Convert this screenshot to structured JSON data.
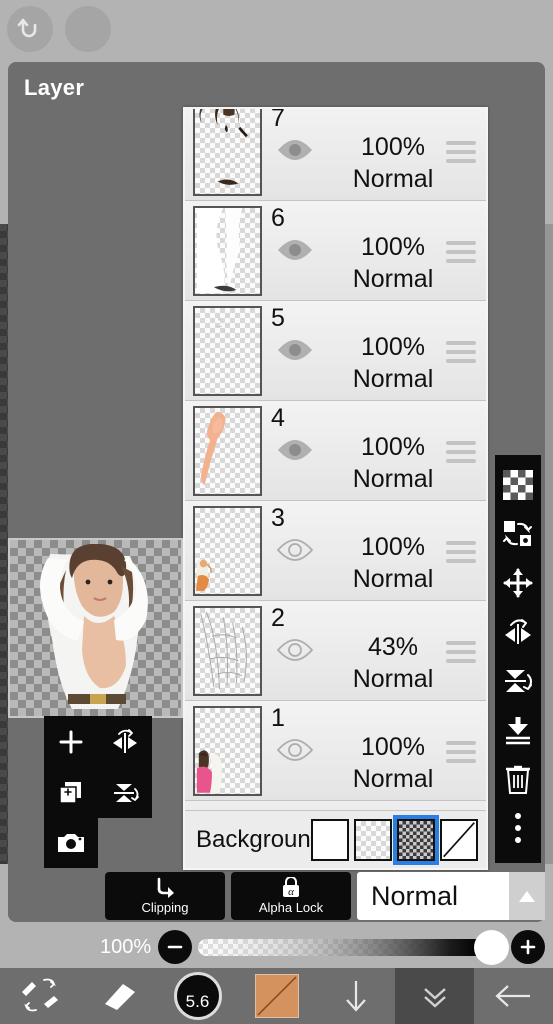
{
  "app": {
    "title": "Layer",
    "accent_blue": "#2a7fe0",
    "panel_gray": "#6e6e6e",
    "list_bg": "#ededed"
  },
  "topbar": {
    "undo_icon": "undo-icon",
    "redo_icon": "redo-icon"
  },
  "layers": [
    {
      "num": "7",
      "opacity": "100%",
      "blend": "Normal",
      "visible": true
    },
    {
      "num": "6",
      "opacity": "100%",
      "blend": "Normal",
      "visible": true
    },
    {
      "num": "5",
      "opacity": "100%",
      "blend": "Normal",
      "visible": true
    },
    {
      "num": "4",
      "opacity": "100%",
      "blend": "Normal",
      "visible": true
    },
    {
      "num": "3",
      "opacity": "100%",
      "blend": "Normal",
      "visible": false
    },
    {
      "num": "2",
      "opacity": "43%",
      "blend": "Normal",
      "visible": false
    },
    {
      "num": "1",
      "opacity": "100%",
      "blend": "Normal",
      "visible": false
    }
  ],
  "background": {
    "label": "Background",
    "options": [
      "white",
      "light-checker",
      "dark-checker",
      "transparent-slash"
    ],
    "selected_index": 2
  },
  "controls": {
    "clipping_label": "Clipping",
    "clipping_icon": "clipping-arrow-icon",
    "alpha_lock_label": "Alpha Lock",
    "alpha_lock_icon": "alpha-lock-icon",
    "blend_mode": "Normal",
    "blend_arrow_icon": "chevron-up-icon",
    "opacity_label": "100%",
    "minus_icon": "minus-icon",
    "plus_icon": "plus-icon"
  },
  "left_tools": [
    {
      "name": "add-layer",
      "icon": "plus-icon"
    },
    {
      "name": "flip-horizontal",
      "icon": "flip-horizontal-icon"
    },
    {
      "name": "duplicate-layer",
      "icon": "duplicate-layer-icon"
    },
    {
      "name": "flip-vertical",
      "icon": "flip-vertical-icon"
    },
    {
      "name": "camera-import",
      "icon": "camera-icon"
    }
  ],
  "right_tools": [
    {
      "name": "transparency",
      "icon": "checkerboard-icon"
    },
    {
      "name": "swap-layers",
      "icon": "swap-layers-icon"
    },
    {
      "name": "move",
      "icon": "move-icon"
    },
    {
      "name": "flip-horizontal",
      "icon": "flip-horizontal-icon"
    },
    {
      "name": "flip-vertical",
      "icon": "flip-vertical-icon"
    },
    {
      "name": "merge-down",
      "icon": "merge-down-icon"
    },
    {
      "name": "delete-layer",
      "icon": "trash-icon"
    },
    {
      "name": "more-options",
      "icon": "more-vertical-icon"
    }
  ],
  "bottombar": {
    "items": [
      {
        "name": "brush-eraser-swap",
        "icon": "brush-eraser-swap-icon",
        "active": false
      },
      {
        "name": "eraser",
        "icon": "eraser-icon",
        "active": false
      },
      {
        "name": "brush-size",
        "icon": "brush-size-icon",
        "active": false,
        "value": "5.6"
      },
      {
        "name": "color-swatch",
        "icon": "color-swatch-icon",
        "active": false,
        "color": "#d4925e"
      },
      {
        "name": "download",
        "icon": "arrow-down-icon",
        "active": false
      },
      {
        "name": "collapse-panel",
        "icon": "double-chevron-down-icon",
        "active": true
      },
      {
        "name": "back",
        "icon": "arrow-left-icon",
        "active": false
      }
    ]
  }
}
